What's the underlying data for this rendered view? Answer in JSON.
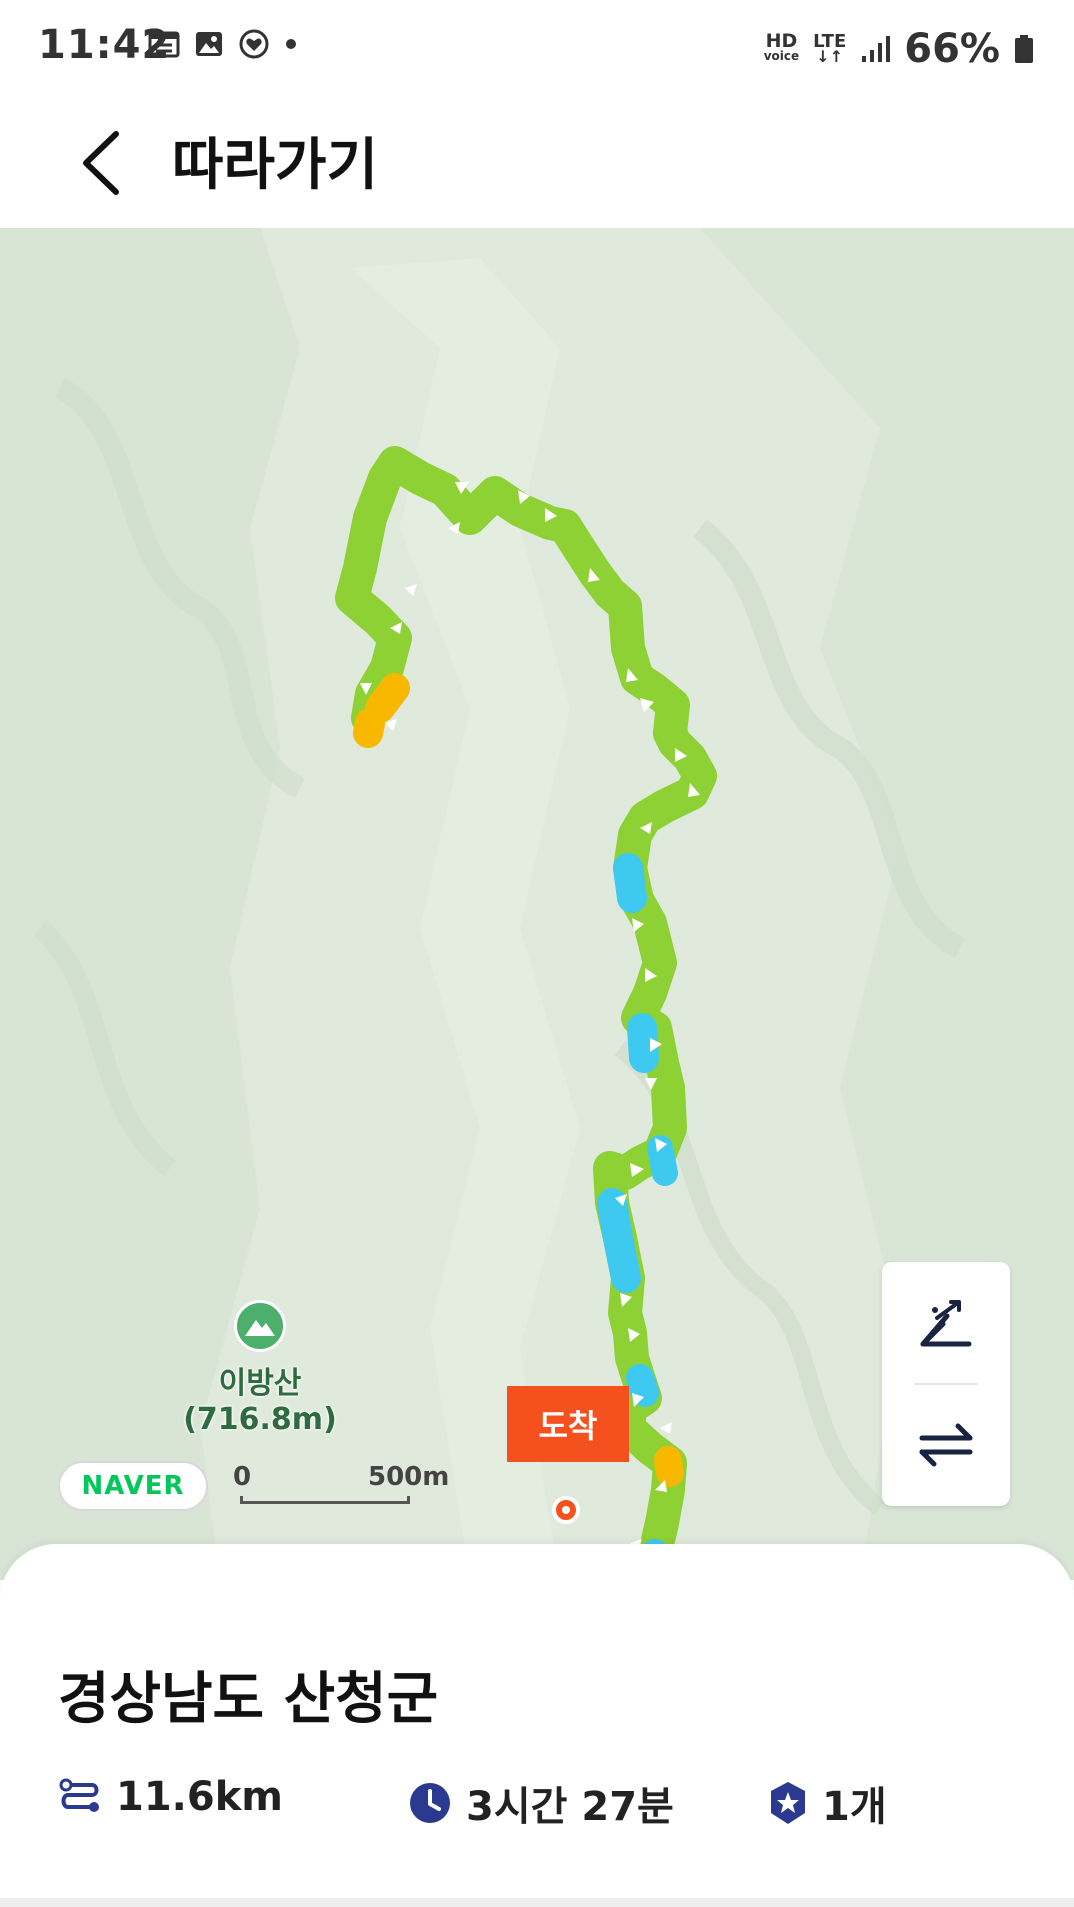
{
  "status_bar": {
    "time": "11:42",
    "hd_label": "HD",
    "voice_label": "voice",
    "lte_label": "LTE",
    "battery": "66%",
    "icons": [
      "calendar-icon",
      "gallery-icon",
      "heart-app-icon",
      "dot-icon",
      "signal-icon",
      "battery-icon"
    ]
  },
  "header": {
    "title": "따라가기",
    "back_icon": "chevron-left-icon"
  },
  "map": {
    "provider": "NAVER",
    "scale_start": "0",
    "scale_end": "500m",
    "poi": {
      "name": "이방산",
      "elevation": "(716.8m)",
      "icon": "mountain-icon"
    },
    "arrival_label": "도착",
    "controls": [
      "elevation-icon",
      "reverse-direction-icon"
    ],
    "colors": {
      "route_main": "#8dd134",
      "route_blue": "#3ec9f0",
      "route_orange": "#f8b800",
      "arrival": "#f4511e"
    }
  },
  "summary": {
    "region": "경상남도 산청군",
    "distance": "11.6km",
    "duration": "3시간 27분",
    "badges": "1개",
    "icons": [
      "route-icon",
      "clock-icon",
      "badge-icon"
    ],
    "icon_color": "#2b3a8f"
  }
}
